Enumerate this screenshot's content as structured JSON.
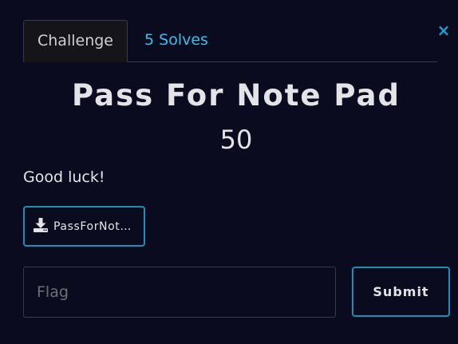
{
  "modal": {
    "close_glyph": "×"
  },
  "tabs": [
    {
      "label": "Challenge",
      "active": true
    },
    {
      "label": "5 Solves",
      "active": false
    }
  ],
  "challenge": {
    "name": "Pass For Note Pad",
    "points": "50",
    "description": "Good luck!",
    "file": {
      "label": "PassForNot…",
      "icon": "download-icon"
    }
  },
  "flag_input": {
    "value": "",
    "placeholder": "Flag"
  },
  "submit": {
    "label": "Submit"
  },
  "colors": {
    "background": "#0b0b20",
    "accent": "#1a8fb3",
    "tab_link": "#34c0ec",
    "text": "#e4e4e8"
  }
}
